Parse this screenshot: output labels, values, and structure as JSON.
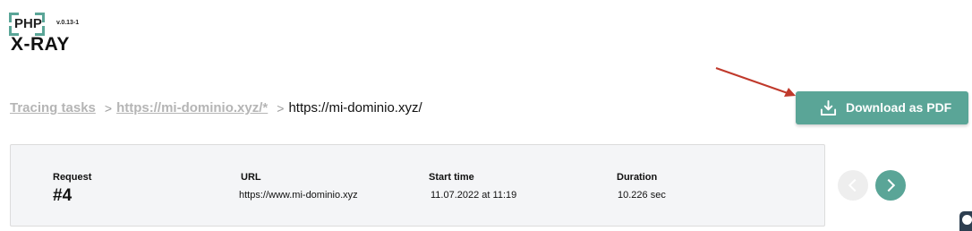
{
  "logo": {
    "php": "PHP",
    "version": "v.0.13-1",
    "name": "X-RAY"
  },
  "breadcrumb": {
    "items": [
      "Tracing tasks",
      "https://mi-dominio.xyz/*"
    ],
    "current": "https://mi-dominio.xyz/"
  },
  "download_button": {
    "label": "Download as PDF"
  },
  "request": {
    "headers": {
      "request": "Request",
      "url": "URL",
      "start_time": "Start time",
      "duration": "Duration"
    },
    "values": {
      "request": "#4",
      "url": "https://www.mi-dominio.xyz",
      "start_time": "11.07.2022 at 11:19",
      "duration": "10.226 sec"
    }
  },
  "colors": {
    "accent": "#5aa597",
    "annotation_arrow": "#c0392b",
    "muted": "#b5b5b5"
  },
  "icons": [
    "download-icon",
    "chevron-right-icon",
    "chevron-left-icon",
    "arrow-annotation"
  ]
}
